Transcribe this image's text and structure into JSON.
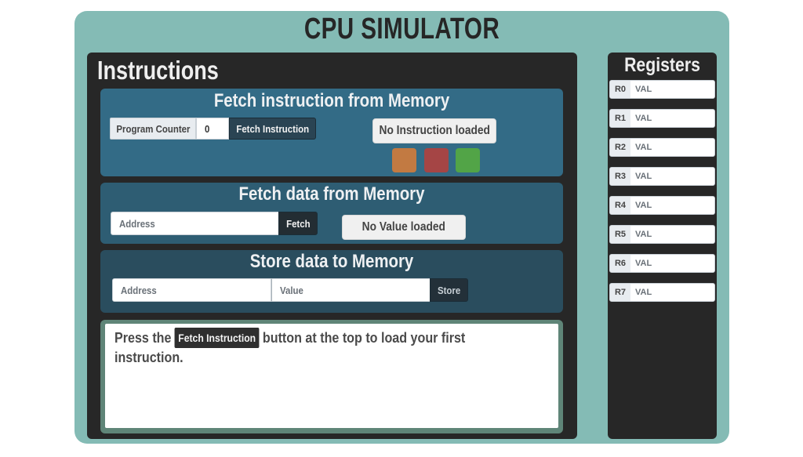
{
  "app": {
    "title": "CPU SIMULATOR"
  },
  "instructions": {
    "title": "Instructions",
    "fetch_instruction": {
      "title": "Fetch instruction from Memory",
      "program_counter_label": "Program Counter",
      "program_counter_value": "0",
      "button_label": "Fetch Instruction",
      "status": "No Instruction loaded",
      "indicators": [
        {
          "name": "orange",
          "color": "#c27a42"
        },
        {
          "name": "red",
          "color": "#a54545"
        },
        {
          "name": "green",
          "color": "#52a447"
        }
      ]
    },
    "fetch_data": {
      "title": "Fetch data from Memory",
      "address_placeholder": "Address",
      "button_label": "Fetch",
      "status": "No Value loaded"
    },
    "store_data": {
      "title": "Store data to Memory",
      "address_placeholder": "Address",
      "value_placeholder": "Value",
      "button_label": "Store"
    },
    "message": {
      "before": "Press the ",
      "button_label": "Fetch Instruction",
      "after": " button at the top to load your first instruction."
    }
  },
  "registers": {
    "title": "Registers",
    "items": [
      {
        "name": "R0",
        "value": "VAL"
      },
      {
        "name": "R1",
        "value": "VAL"
      },
      {
        "name": "R2",
        "value": "VAL"
      },
      {
        "name": "R3",
        "value": "VAL"
      },
      {
        "name": "R4",
        "value": "VAL"
      },
      {
        "name": "R5",
        "value": "VAL"
      },
      {
        "name": "R6",
        "value": "VAL"
      },
      {
        "name": "R7",
        "value": "VAL"
      }
    ]
  }
}
